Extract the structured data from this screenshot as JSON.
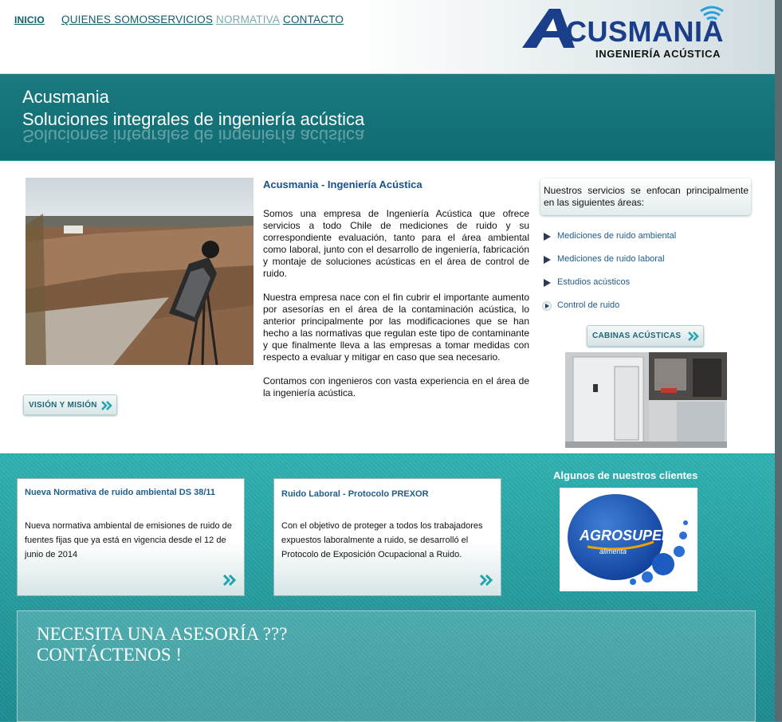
{
  "nav": {
    "items": [
      {
        "label": "INICIO"
      },
      {
        "label": "QUIENES SOMOS"
      },
      {
        "label": "SERVICIOS"
      },
      {
        "label": "NORMATIVA"
      },
      {
        "label": "CONTACTO"
      }
    ]
  },
  "logo": {
    "name": "ACUSMANIA",
    "tagline": "INGENIERÍA ACÚSTICA"
  },
  "banner": {
    "line1": "Acusmania",
    "line2": "Soluciones integrales de ingeniería acústica"
  },
  "intro": {
    "heading": "Acusmania - Ingeniería Acústica",
    "paragraphs": [
      "Somos una empresa de Ingeniería Acústica que ofrece servicios a todo Chile de mediciones de ruido y su correspondiente evaluación, tanto para el área ambiental como laboral, junto con el desarrollo de ingeniería, fabricación y montaje de soluciones acústicas en el área de control de ruido.",
      "Nuestra empresa nace con el fin cubrir el importante aumento por asesorías en el área de la contaminación acústica, lo anterior principalmente por las modificaciones que se han hecho a las normativas que regulan este tipo de contaminante y que finalmente lleva a las empresas a tomar medidas con respecto a evaluar y mitigar en caso que sea necesario.",
      "Contamos con ingenieros con vasta experiencia en el área de la ingeniería acústica."
    ],
    "vision_button": "VISIÓN Y MISIÓN"
  },
  "services": {
    "intro": "Nuestros servicios se enfocan principalmente en las siguientes áreas:",
    "items": [
      {
        "label": "Mediciones de ruido ambiental"
      },
      {
        "label": "Mediciones de ruido laboral"
      },
      {
        "label": "Estudios acústicos"
      },
      {
        "label": "Control de ruido"
      }
    ],
    "cabinas_button": "CABINAS ACÚSTICAS"
  },
  "news": [
    {
      "title": "Nueva Normativa de ruido ambiental DS 38/11",
      "body": "Nueva normativa ambiental de emisiones de ruido de fuentes fijas que ya está en vigencia desde el 12 de junio de 2014"
    },
    {
      "title": "Ruido Laboral - Protocolo PREXOR",
      "body": "Con el objetivo de proteger a todos los trabajadores expuestos laboralmente a ruido, se desarrolló el Protocolo de Exposición Ocupacional a Ruido."
    }
  ],
  "clients": {
    "title": "Algunos de nuestros clientes",
    "logo_name": "AGROSUPER",
    "logo_sub": "alimenta"
  },
  "cta": {
    "line1": "NECESITA UNA ASESORÍA ???",
    "line2": "CONTÁCTENOS !"
  },
  "colors": {
    "teal_banner": "#0f6c72",
    "teal_lower": "#2a9a9c",
    "link": "#0e5d6d",
    "heading_blue": "#1a4f8c"
  }
}
